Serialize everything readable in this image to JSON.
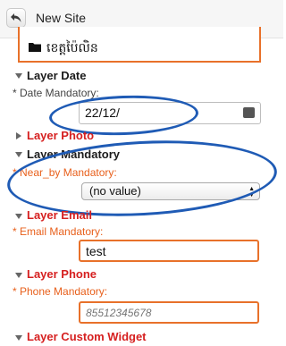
{
  "header": {
    "title": "New Site"
  },
  "site_field": {
    "value": "ខេត្តប៉ៃលិន",
    "icon": "folder-icon"
  },
  "sections": {
    "layer_date": {
      "title": "Layer Date",
      "label": "* Date Mandatory:",
      "value": "22/12/"
    },
    "layer_photo": {
      "title": "Layer Photo"
    },
    "layer_mandatory": {
      "title": "Layer Mandatory",
      "label": "* Near_by Mandatory:",
      "selected": "(no value)"
    },
    "layer_email": {
      "title": "Layer Email",
      "label": "* Email Mandatory:",
      "value": "test"
    },
    "layer_phone": {
      "title": "Layer Phone",
      "label": "* Phone Mandatory:",
      "placeholder": "85512345678"
    },
    "layer_custom": {
      "title": "Layer Custom Widget"
    }
  },
  "colors": {
    "accent_orange": "#e8712a",
    "required_red": "#d62020",
    "annotation_blue": "#1f5bb5"
  }
}
